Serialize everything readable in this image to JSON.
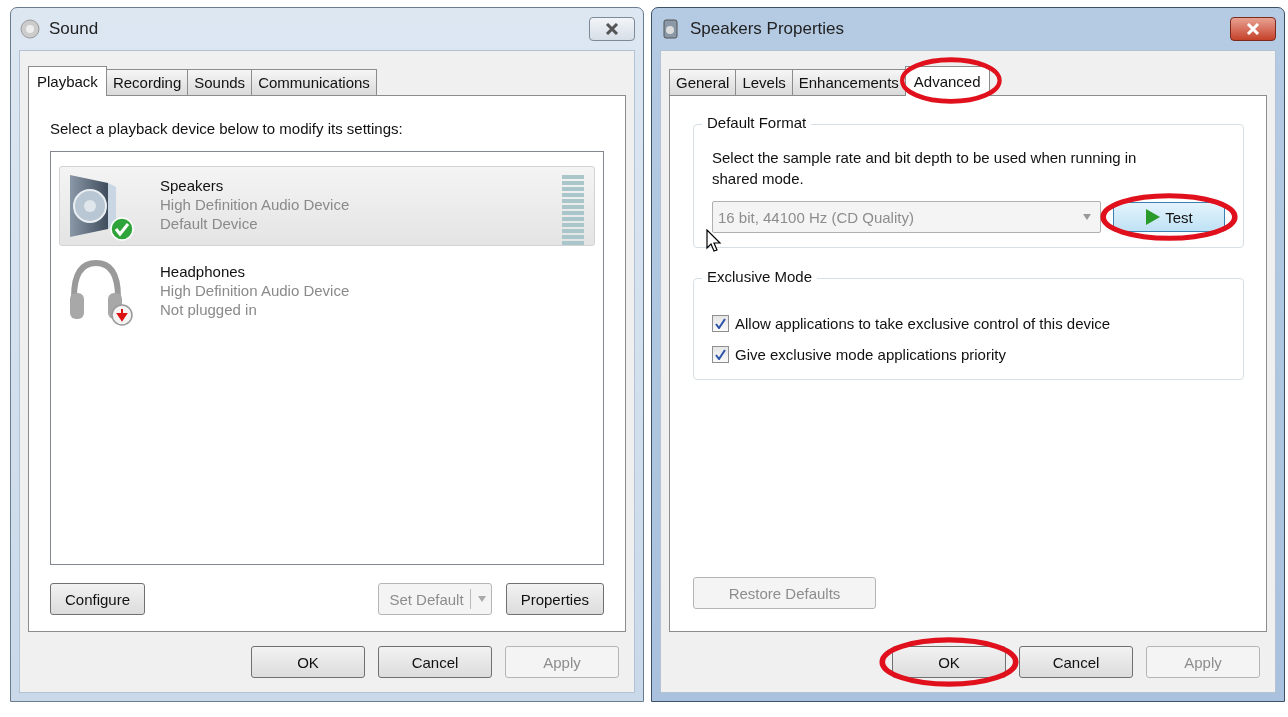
{
  "sound_window": {
    "title": "Sound",
    "active": false,
    "tabs": [
      {
        "label": "Playback",
        "selected": true
      },
      {
        "label": "Recording",
        "selected": false
      },
      {
        "label": "Sounds",
        "selected": false
      },
      {
        "label": "Communications",
        "selected": false
      }
    ],
    "instruction": "Select a playback device below to modify its settings:",
    "devices": [
      {
        "kind": "speakers",
        "name": "Speakers",
        "description": "High Definition Audio Device",
        "status": "Default Device",
        "default": true,
        "unplugged": false,
        "selected": true
      },
      {
        "kind": "headphones",
        "name": "Headphones",
        "description": "High Definition Audio Device",
        "status": "Not plugged in",
        "default": false,
        "unplugged": true,
        "selected": false
      }
    ],
    "panel_buttons": [
      {
        "kind": "plain",
        "label": "Configure",
        "disabled": false
      },
      {
        "kind": "split",
        "label": "Set Default",
        "disabled": true
      },
      {
        "kind": "plain",
        "label": "Properties",
        "disabled": false
      }
    ],
    "footer_buttons": [
      {
        "label": "OK",
        "disabled": false
      },
      {
        "label": "Cancel",
        "disabled": false
      },
      {
        "label": "Apply",
        "disabled": true
      }
    ]
  },
  "properties_window": {
    "title": "Speakers Properties",
    "active": true,
    "tabs": [
      {
        "label": "General",
        "selected": false,
        "circled": false
      },
      {
        "label": "Levels",
        "selected": false,
        "circled": false
      },
      {
        "label": "Enhancements",
        "selected": false,
        "circled": false
      },
      {
        "label": "Advanced",
        "selected": true,
        "circled": true
      }
    ],
    "default_format": {
      "title": "Default Format",
      "description": "Select the sample rate and bit depth to be used when running in shared mode.",
      "format": {
        "value": "16 bit, 44100 Hz (CD Quality)",
        "disabled": true
      },
      "test_button": {
        "label": "Test",
        "circled": true
      }
    },
    "exclusive_mode": {
      "title": "Exclusive Mode",
      "options": [
        {
          "label": "Allow applications to take exclusive control of this device",
          "checked": true
        },
        {
          "label": "Give exclusive mode applications priority",
          "checked": true
        }
      ]
    },
    "restore_button": {
      "label": "Restore Defaults",
      "disabled": true
    },
    "footer_buttons": [
      {
        "label": "OK",
        "disabled": false,
        "circled": true
      },
      {
        "label": "Cancel",
        "disabled": false,
        "circled": false
      },
      {
        "label": "Apply",
        "disabled": true,
        "circled": false
      }
    ]
  }
}
